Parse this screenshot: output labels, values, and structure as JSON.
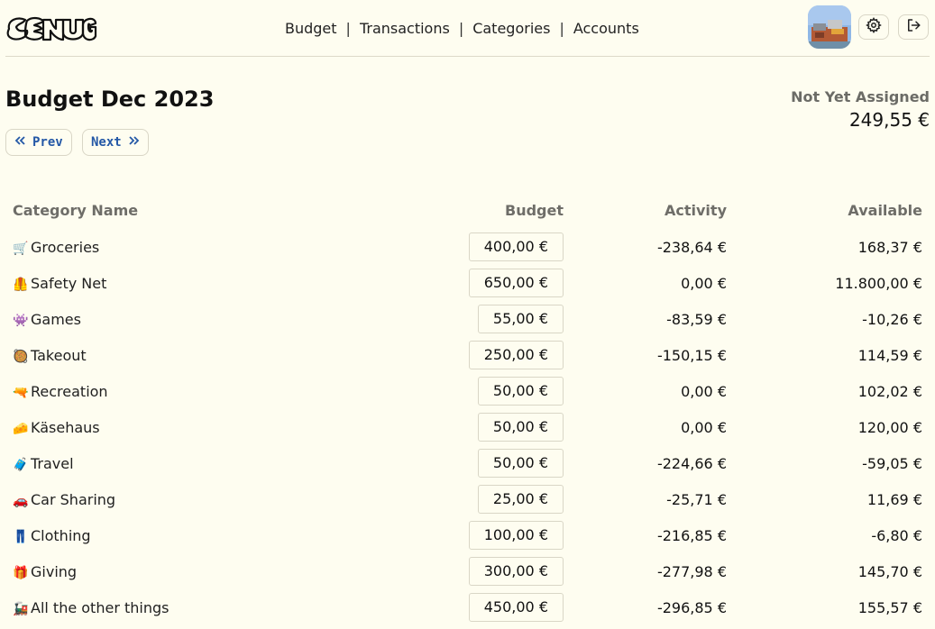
{
  "nav": {
    "items": [
      "Budget",
      "Transactions",
      "Categories",
      "Accounts"
    ],
    "separator": "|"
  },
  "page": {
    "title": "Budget Dec 2023",
    "prev_label": "Prev",
    "next_label": "Next",
    "not_yet_assigned_label": "Not Yet Assigned",
    "not_yet_assigned_value": "249,55 €"
  },
  "table": {
    "headers": [
      "Category Name",
      "Budget",
      "Activity",
      "Available"
    ],
    "rows": [
      {
        "emoji": "🛒",
        "name": "Groceries",
        "budget": "400,00 €",
        "activity": "-238,64 €",
        "available": "168,37 €"
      },
      {
        "emoji": "🦺",
        "name": "Safety Net",
        "budget": "650,00 €",
        "activity": "0,00 €",
        "available": "11.800,00 €"
      },
      {
        "emoji": "👾",
        "name": "Games",
        "budget": "55,00 €",
        "activity": "-83,59 €",
        "available": "-10,26 €"
      },
      {
        "emoji": "🥘",
        "name": "Takeout",
        "budget": "250,00 €",
        "activity": "-150,15 €",
        "available": "114,59 €"
      },
      {
        "emoji": "🔫",
        "name": "Recreation",
        "budget": "50,00 €",
        "activity": "0,00 €",
        "available": "102,02 €"
      },
      {
        "emoji": "🧀",
        "name": "Käsehaus",
        "budget": "50,00 €",
        "activity": "0,00 €",
        "available": "120,00 €"
      },
      {
        "emoji": "🧳",
        "name": "Travel",
        "budget": "50,00 €",
        "activity": "-224,66 €",
        "available": "-59,05 €"
      },
      {
        "emoji": "🚗",
        "name": "Car Sharing",
        "budget": "25,00 €",
        "activity": "-25,71 €",
        "available": "11,69 €"
      },
      {
        "emoji": "👖",
        "name": "Clothing",
        "budget": "100,00 €",
        "activity": "-216,85 €",
        "available": "-6,80 €"
      },
      {
        "emoji": "🎁",
        "name": "Giving",
        "budget": "300,00 €",
        "activity": "-277,98 €",
        "available": "145,70 €"
      },
      {
        "emoji": "🚂",
        "name": "All the other things",
        "budget": "450,00 €",
        "activity": "-296,85 €",
        "available": "155,57 €"
      }
    ]
  },
  "icons": {
    "logo": "graffiti-logo",
    "settings": "gear-icon",
    "logout": "logout-icon",
    "prev": "chevrons-left-icon",
    "next": "chevrons-right-icon"
  },
  "colors": {
    "background": "#fefdf0",
    "link_button_text": "#2458a6",
    "header_text": "#6e6d68"
  }
}
